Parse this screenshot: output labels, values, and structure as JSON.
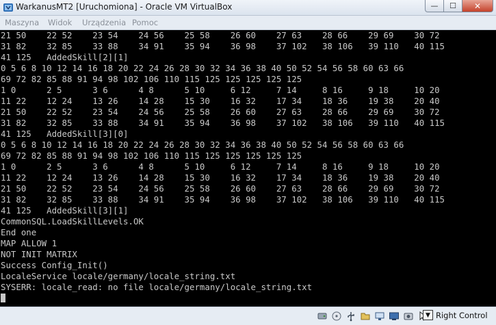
{
  "window": {
    "title": "WarkanusMT2 [Uruchomiona] - Oracle VM VirtualBox",
    "minimize_glyph": "—",
    "maximize_glyph": "☐",
    "close_glyph": "✕"
  },
  "menu": {
    "items": [
      "Maszyna",
      "Widok",
      "Urządzenia",
      "Pomoc"
    ]
  },
  "console": {
    "lines": [
      "21 50    22 52    23 54    24 56    25 58    26 60    27 63    28 66    29 69    30 72",
      "31 82    32 85    33 88    34 91    35 94    36 98    37 102   38 106   39 110   40 115",
      "41 125   AddedSkill[2][1]",
      "0 5 6 8 10 12 14 16 18 20 22 24 26 28 30 32 34 36 38 40 50 52 54 56 58 60 63 66",
      "69 72 82 85 88 91 94 98 102 106 110 115 125 125 125 125 125",
      "1 0      2 5      3 6      4 8      5 10     6 12     7 14     8 16     9 18     10 20",
      "11 22    12 24    13 26    14 28    15 30    16 32    17 34    18 36    19 38    20 40",
      "21 50    22 52    23 54    24 56    25 58    26 60    27 63    28 66    29 69    30 72",
      "31 82    32 85    33 88    34 91    35 94    36 98    37 102   38 106   39 110   40 115",
      "41 125   AddedSkill[3][0]",
      "0 5 6 8 10 12 14 16 18 20 22 24 26 28 30 32 34 36 38 40 50 52 54 56 58 60 63 66",
      "69 72 82 85 88 91 94 98 102 106 110 115 125 125 125 125 125",
      "1 0      2 5      3 6      4 8      5 10     6 12     7 14     8 16     9 18     10 20",
      "11 22    12 24    13 26    14 28    15 30    16 32    17 34    18 36    19 38    20 40",
      "21 50    22 52    23 54    24 56    25 58    26 60    27 63    28 66    29 69    30 72",
      "31 82    32 85    33 88    34 91    35 94    36 98    37 102   38 106   39 110   40 115",
      "41 125   AddedSkill[3][1]",
      "CommonSQL.LoadSkillLevels.OK",
      "End one",
      "MAP ALLOW 1",
      "NOT INIT MATRIX",
      "Success Config_Init()",
      "LocaleService locale/germany/locale_string.txt",
      "SYSERR: locale_read: no file locale/germany/locale_string.txt"
    ]
  },
  "statusbar": {
    "icons": [
      "hard-disk-icon",
      "optical-drive-icon",
      "usb-icon",
      "shared-folder-icon",
      "network-icon",
      "display-icon",
      "capture-icon",
      "mouse-integration-icon"
    ],
    "host_key_label": "Right Control",
    "host_key_icon": "down-arrow-icon"
  },
  "colors": {
    "console_bg": "#000000",
    "console_text": "#c8c8c8",
    "close_button": "#c4422b",
    "chrome": "#dfe6ef"
  }
}
